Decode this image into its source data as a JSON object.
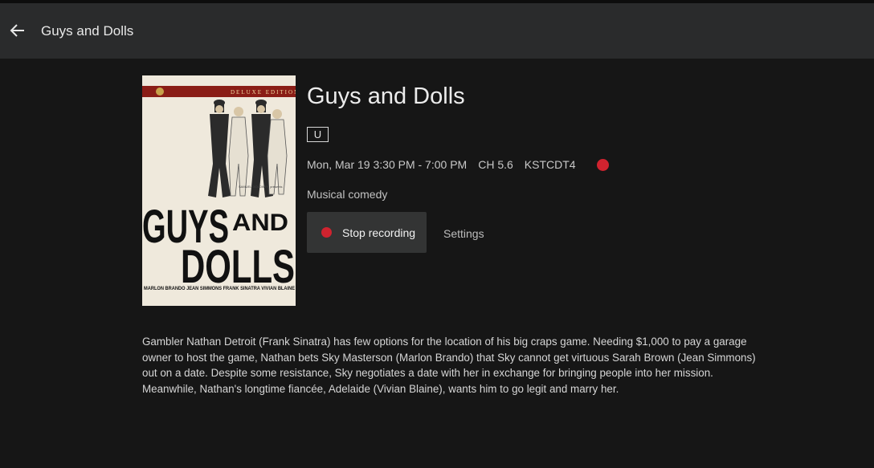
{
  "header": {
    "back_icon": "arrow-left-icon",
    "title": "Guys and Dolls"
  },
  "poster": {
    "edition_text": "DELUXE EDITION",
    "title_line1": "GUYS",
    "title_line2": "AND",
    "title_line3": "DOLLS",
    "credits": "MARLON BRANDO  JEAN SIMMONS  FRANK SINATRA  VIVIAN BLAINE",
    "studio_text": "SAMUEL GOLDWYN presents"
  },
  "program": {
    "title": "Guys and Dolls",
    "rating": "U",
    "time": "Mon, Mar 19 3:30 PM - 7:00 PM",
    "channel": "CH 5.6",
    "station": "KSTCDT4",
    "recording_indicator_color": "#d0232f",
    "genre": "Musical comedy",
    "description": "Gambler Nathan Detroit (Frank Sinatra) has few options for the location of his big craps game. Needing $1,000 to pay a garage owner to host the game, Nathan bets Sky Masterson (Marlon Brando) that Sky cannot get virtuous Sarah Brown (Jean Simmons) out on a date. Despite some resistance, Sky negotiates a date with her in exchange for bringing people into her mission. Meanwhile, Nathan's longtime fiancée, Adelaide (Vivian Blaine), wants him to go legit and marry her."
  },
  "actions": {
    "stop_recording_label": "Stop recording",
    "settings_label": "Settings"
  }
}
